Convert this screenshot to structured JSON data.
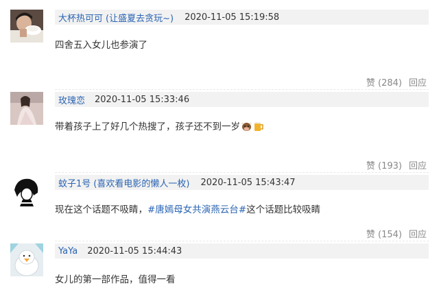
{
  "comments": [
    {
      "username": "大杯热可可",
      "user_extra": "(让盛夏去贪玩~)",
      "time": "2020-11-05 15:19:58",
      "text": "四舍五入女儿也参演了",
      "likes": "赞 (284)",
      "reply": "回应"
    },
    {
      "username": "玫瑰恋",
      "user_extra": "",
      "time": "2020-11-05 15:33:46",
      "text": "带着孩子上了好几个热搜了，孩子还不到一岁",
      "emoji_1": "cow-face-emoji",
      "emoji_2": "beer-mug-emoji",
      "likes": "赞 (193)",
      "reply": "回应"
    },
    {
      "username": "蚊子1号",
      "user_extra": "(喜欢看电影的懒人一枚)",
      "time": "2020-11-05 15:43:47",
      "text_before": "现在这个话题不吸睛，",
      "hashtag": "#唐嫣母女共演燕云台#",
      "text_after": "这个话题比较吸睛",
      "likes": "赞 (154)",
      "reply": "回应"
    },
    {
      "username": "YaYa",
      "user_extra": "",
      "time": "2020-11-05 15:44:43",
      "text": "女儿的第一部作品，值得一看"
    }
  ],
  "colors": {
    "link": "#2a64b3",
    "header_bg": "#f2f2f2",
    "muted": "#888888",
    "text": "#333333"
  }
}
